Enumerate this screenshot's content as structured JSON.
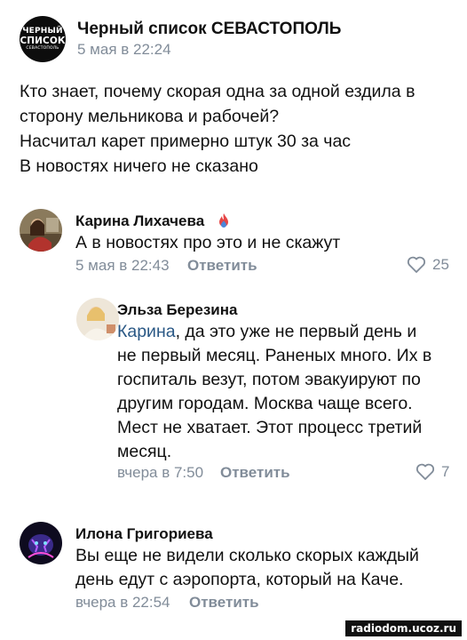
{
  "post": {
    "author": "Черный список СЕВАСТОПОЛЬ",
    "date": "5 мая в 22:24",
    "avatar_text": {
      "line1": "ЧЕРНЫЙ",
      "line2": "СПИСОК",
      "line3": "СЕВАСТОПОЛЬ"
    },
    "text_lines": [
      "Кто знает, почему скорая одна за одной ездила в",
      "сторону мельникова и рабочей?",
      "Насчитал карет примерно штук 30 за час",
      "В новостях ничего не сказано"
    ]
  },
  "comments": [
    {
      "author": "Карина Лихачева",
      "badge_icon": "flame-icon",
      "text_lines": [
        "А в новостях про это и не скажут"
      ],
      "date": "5 мая в 22:43",
      "reply_label": "Ответить",
      "likes": "25"
    },
    {
      "author": "Эльза Березина",
      "mention": "Карина",
      "text_first_rest": ", да это уже не первый день и",
      "text_lines": [
        "не первый месяц. Раненых много. Их в",
        "госпиталь везут, потом эвакуируют по",
        "другим городам. Москва чаще всего.",
        "Мест не хватает. Этот процесс третий",
        "месяц."
      ],
      "date": "вчера в 7:50",
      "reply_label": "Ответить",
      "likes": "7"
    },
    {
      "author": "Илона Григориева",
      "text_lines": [
        "Вы еще не видели сколько скорых каждый",
        "день едут с аэропорта, который на Каче."
      ],
      "date": "вчера в 22:54",
      "reply_label": "Ответить"
    }
  ],
  "watermark": "radiodom.ucoz.ru",
  "colors": {
    "meta": "#818c99",
    "mention": "#2a5885",
    "text": "#111111"
  }
}
